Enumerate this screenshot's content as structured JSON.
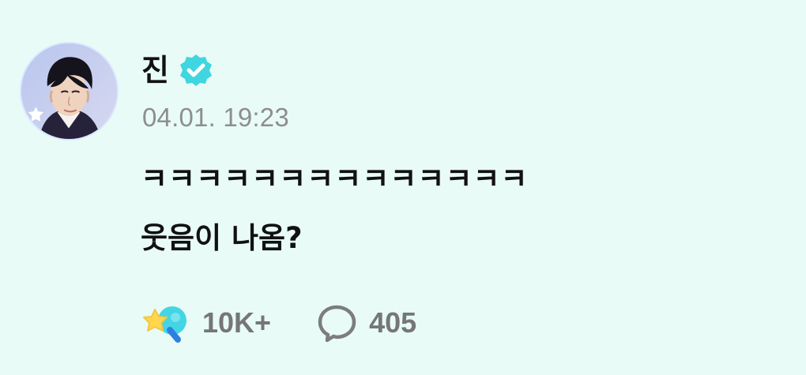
{
  "post": {
    "author": {
      "name": "진",
      "verified_icon": "verified-badge-icon",
      "avatar_badge_icon": "star-icon"
    },
    "timestamp": "04.01. 19:23",
    "lines": [
      "ㅋㅋㅋㅋㅋㅋㅋㅋㅋㅋㅋㅋㅋㅋ",
      "웃음이 나옴?"
    ],
    "stats": {
      "likes": "10K+",
      "comments": "405",
      "like_icon": "star-pick-icon",
      "comment_icon": "comment-bubble-icon"
    },
    "colors": {
      "background": "#e8fbf7",
      "text": "#111111",
      "muted": "#8e8e8e",
      "accent": "#34d1d8"
    }
  }
}
